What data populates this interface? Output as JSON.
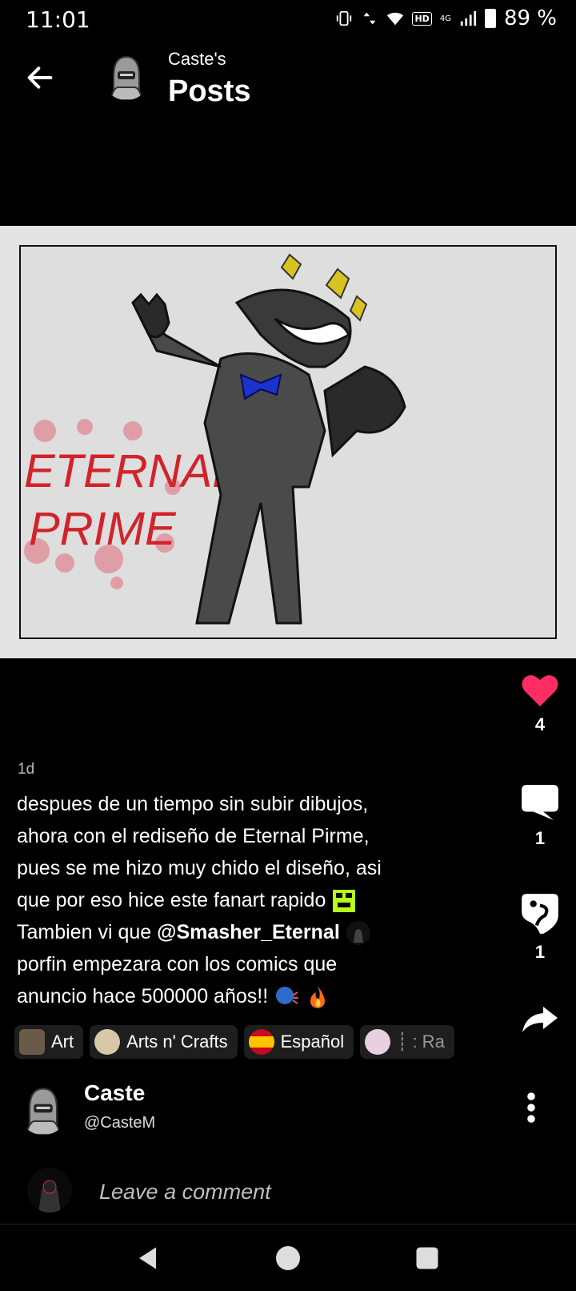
{
  "status_bar": {
    "time": "11:01",
    "network": "4G",
    "hd_label": "HD",
    "battery": "89 %"
  },
  "header": {
    "subtitle": "Caste's",
    "title": "Posts"
  },
  "post": {
    "artwork_text": [
      "ETERNAL",
      "PRIME"
    ],
    "age": "1d",
    "text_lines": [
      "despues de un tiempo sin subir dibujos,",
      "ahora con el rediseño de Eternal Pirme,",
      "pues se me hizo muy chido el diseño, asi",
      "que por eso hice este fanart rapido"
    ],
    "line5_prefix": "Tambien vi que ",
    "mention": "@Smasher_Eternal",
    "line6": "porfin empezara con los comics que",
    "line7": "anuncio hace 500000 años!!",
    "tags": [
      "Art",
      "Arts n' Crafts",
      "Español",
      "┊ : Ra"
    ]
  },
  "actions": {
    "likes": "4",
    "comments": "1",
    "props": "1"
  },
  "author": {
    "name": "Caste",
    "handle": "@CasteM"
  },
  "comment": {
    "placeholder": "Leave a comment"
  },
  "colors": {
    "like": "#ff2d62",
    "background": "#000000",
    "tag_bg": "#1e1e1e"
  }
}
